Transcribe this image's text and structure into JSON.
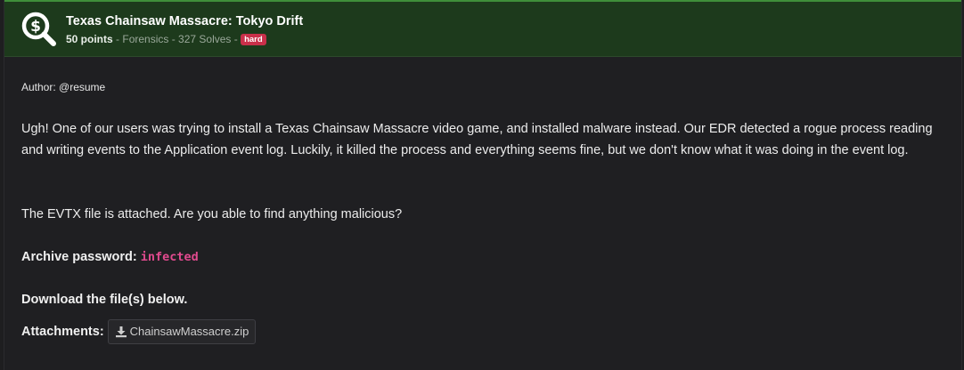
{
  "challenge": {
    "title": "Texas Chainsaw Massacre: Tokyo Drift",
    "points": "50 points",
    "category": "Forensics",
    "solves": "327 Solves",
    "separator": " - ",
    "difficulty": "hard",
    "icon": "magnifier-dollar-icon",
    "accent_color": "#3f8f3a",
    "badge_color": "#c9304a"
  },
  "content": {
    "author": "Author: @resume",
    "paragraph1": "Ugh! One of our users was trying to install a Texas Chainsaw Massacre video game, and installed malware instead. Our EDR detected a rogue process reading and writing events to the Application event log. Luckily, it killed the process and everything seems fine, but we don't know what it was doing in the event log.",
    "paragraph2": "The EVTX file is attached. Are you able to find anything malicious?",
    "password_label": "Archive password:",
    "password_value": "infected",
    "download_text": "Download the file(s) below.",
    "attachments_label": "Attachments:",
    "attachment_file": "ChainsawMassacre.zip",
    "attachment_icon": "download-icon"
  }
}
